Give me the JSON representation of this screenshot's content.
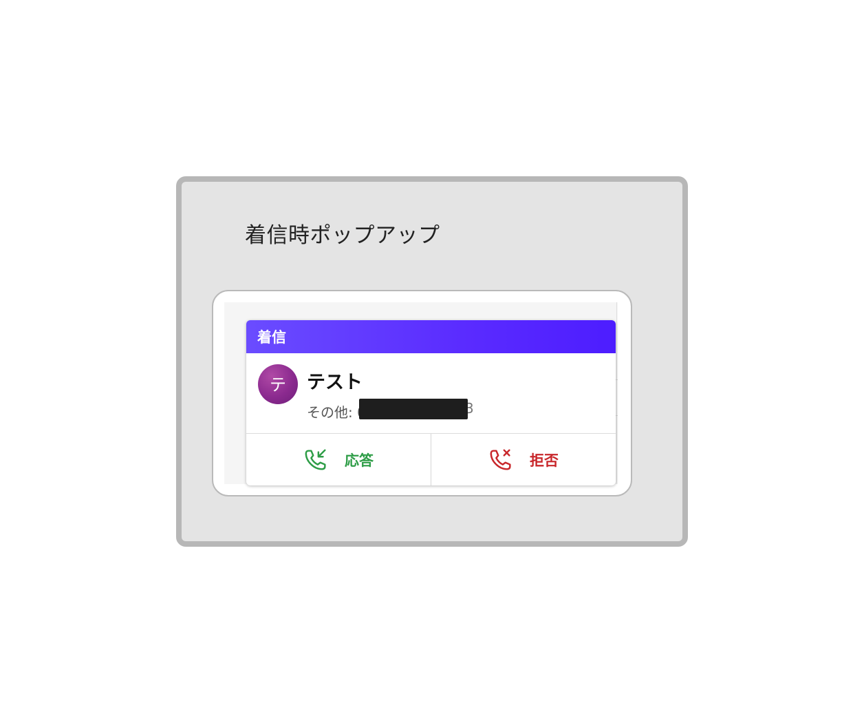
{
  "panel": {
    "title": "着信時ポップアップ"
  },
  "popup": {
    "header_title": "着信",
    "header_color": "#5b2eff",
    "caller": {
      "avatar_initial": "テ",
      "avatar_color": "#8b2a8f",
      "name": "テスト",
      "sub_label": "その他: 0",
      "number_tail": "3"
    },
    "actions": {
      "answer": {
        "label": "応答",
        "icon": "phone-incoming-icon",
        "color": "#2e9d47"
      },
      "reject": {
        "label": "拒否",
        "icon": "phone-missed-icon",
        "color": "#c8272b"
      }
    }
  }
}
